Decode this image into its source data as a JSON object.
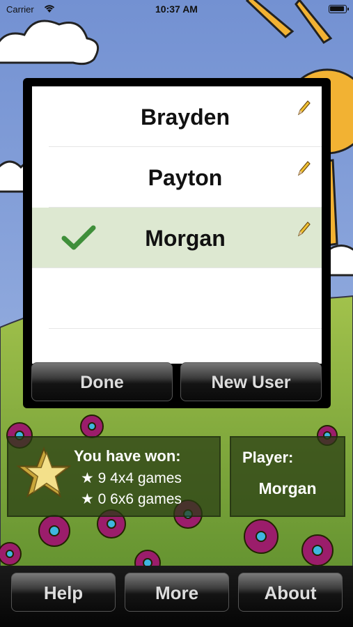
{
  "status_bar": {
    "carrier": "Carrier",
    "time": "10:37 AM"
  },
  "users": [
    {
      "name": "Brayden",
      "selected": false
    },
    {
      "name": "Payton",
      "selected": false
    },
    {
      "name": "Morgan",
      "selected": true
    }
  ],
  "dialog": {
    "done_label": "Done",
    "new_user_label": "New User"
  },
  "stats": {
    "title": "You have won:",
    "line_4x4": "★ 9 4x4 games",
    "line_6x6": "★ 0 6x6 games"
  },
  "player": {
    "label": "Player:",
    "name": "Morgan"
  },
  "bottom_bar": {
    "help_label": "Help",
    "more_label": "More",
    "about_label": "About"
  },
  "colors": {
    "selected_row": "#dde8d1",
    "sky": "#7f9ad6",
    "grass": "#7fae3c",
    "sun": "#f2b233",
    "flower": "#9b1d6b"
  }
}
